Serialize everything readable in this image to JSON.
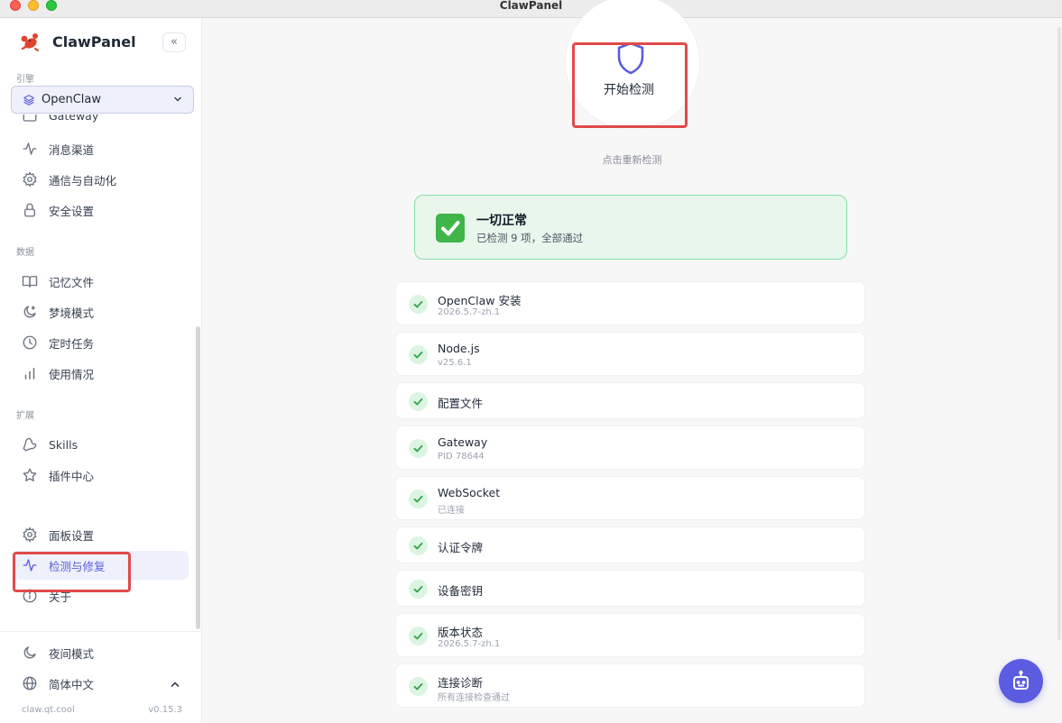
{
  "window": {
    "title": "ClawPanel"
  },
  "brand": {
    "name": "ClawPanel",
    "collapse_glyph": "«"
  },
  "sidebar": {
    "engine_label": "引擎",
    "engine_value": "OpenClaw",
    "clipped_item": "Gateway",
    "items_top": [
      {
        "label": "消息渠道",
        "icon": "activity-icon"
      },
      {
        "label": "通信与自动化",
        "icon": "gear-icon"
      },
      {
        "label": "安全设置",
        "icon": "lock-icon"
      }
    ],
    "data_label": "数据",
    "items_data": [
      {
        "label": "记忆文件",
        "icon": "book-icon"
      },
      {
        "label": "梦境模式",
        "icon": "moon-icon"
      },
      {
        "label": "定时任务",
        "icon": "clock-icon"
      },
      {
        "label": "使用情况",
        "icon": "bar-chart-icon"
      }
    ],
    "ext_label": "扩展",
    "items_ext": [
      {
        "label": "Skills",
        "icon": "wrench-icon"
      },
      {
        "label": "插件中心",
        "icon": "star-icon"
      }
    ],
    "items_bottom": [
      {
        "label": "面板设置",
        "icon": "gear-icon"
      },
      {
        "label": "检测与修复",
        "icon": "activity-icon",
        "active": true
      },
      {
        "label": "关于",
        "icon": "info-icon"
      }
    ],
    "night_mode": "夜间模式",
    "language": "简体中文",
    "footer_site": "claw.qt.cool",
    "footer_version": "v0.15.3"
  },
  "scan": {
    "button_label": "开始检测",
    "hint": "点击重新检测"
  },
  "summary": {
    "title": "一切正常",
    "subtitle": "已检测 9 项，全部通过"
  },
  "checks": [
    {
      "name": "OpenClaw 安装",
      "detail": "2026.5.7-zh.1"
    },
    {
      "name": "Node.js",
      "detail": "v25.6.1"
    },
    {
      "name": "配置文件",
      "detail": ""
    },
    {
      "name": "Gateway",
      "detail": "PID 78644"
    },
    {
      "name": "WebSocket",
      "detail": "已连接"
    },
    {
      "name": "认证令牌",
      "detail": ""
    },
    {
      "name": "设备密钥",
      "detail": ""
    },
    {
      "name": "版本状态",
      "detail": "2026.5.7-zh.1"
    },
    {
      "name": "连接诊断",
      "detail": "所有连接检查通过"
    }
  ],
  "colors": {
    "accent": "#5b5ce0",
    "success": "#3fb54a",
    "highlight": "#e04a4a"
  }
}
